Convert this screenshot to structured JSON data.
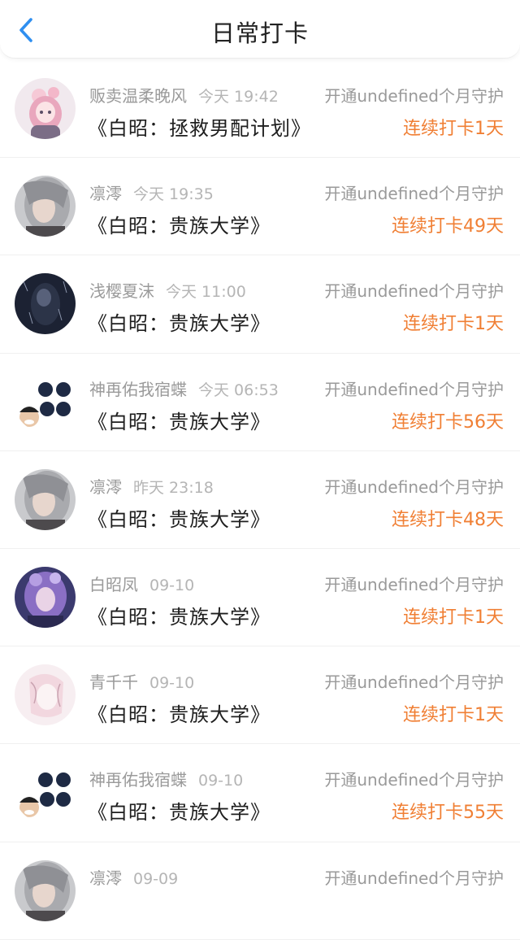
{
  "header": {
    "title": "日常打卡",
    "back_icon": "chevron-left-icon",
    "accent_color": "#2f8ff0"
  },
  "colors": {
    "streak": "#f07f34",
    "muted": "#9a9a9a"
  },
  "items": [
    {
      "name": "贩卖温柔晚风",
      "time": "今天 19:42",
      "book": "《白昭：拯救男配计划》",
      "guard": "开通undefined个月守护",
      "streak": "连续打卡1天",
      "avatar": "pink-anime-girl-avatar"
    },
    {
      "name": "凛澪",
      "time": "今天 19:35",
      "book": "《白昭：贵族大学》",
      "guard": "开通undefined个月守护",
      "streak": "连续打卡49天",
      "avatar": "silver-hair-avatar"
    },
    {
      "name": "浅樱夏沫",
      "time": "今天 11:00",
      "book": "《白昭：贵族大学》",
      "guard": "开通undefined个月守护",
      "streak": "连续打卡1天",
      "avatar": "dark-rain-avatar"
    },
    {
      "name": "神再佑我宿蝶",
      "time": "今天 06:53",
      "book": "《白昭：贵族大学》",
      "guard": "开通undefined个月守护",
      "streak": "连续打卡56天",
      "avatar": "meme-collage-avatar"
    },
    {
      "name": "凛澪",
      "time": "昨天 23:18",
      "book": "《白昭：贵族大学》",
      "guard": "开通undefined个月守护",
      "streak": "连续打卡48天",
      "avatar": "silver-hair-avatar"
    },
    {
      "name": "白昭凤",
      "time": "09-10",
      "book": "《白昭：贵族大学》",
      "guard": "开通undefined个月守护",
      "streak": "连续打卡1天",
      "avatar": "purple-hair-avatar"
    },
    {
      "name": "青千千",
      "time": "09-10",
      "book": "《白昭：贵族大学》",
      "guard": "开通undefined个月守护",
      "streak": "连续打卡1天",
      "avatar": "sketch-girl-avatar"
    },
    {
      "name": "神再佑我宿蝶",
      "time": "09-10",
      "book": "《白昭：贵族大学》",
      "guard": "开通undefined个月守护",
      "streak": "连续打卡55天",
      "avatar": "meme-collage-avatar"
    },
    {
      "name": "凛澪",
      "time": "09-09",
      "book": "",
      "guard": "开通undefined个月守护",
      "streak": "",
      "avatar": "silver-hair-avatar"
    }
  ]
}
